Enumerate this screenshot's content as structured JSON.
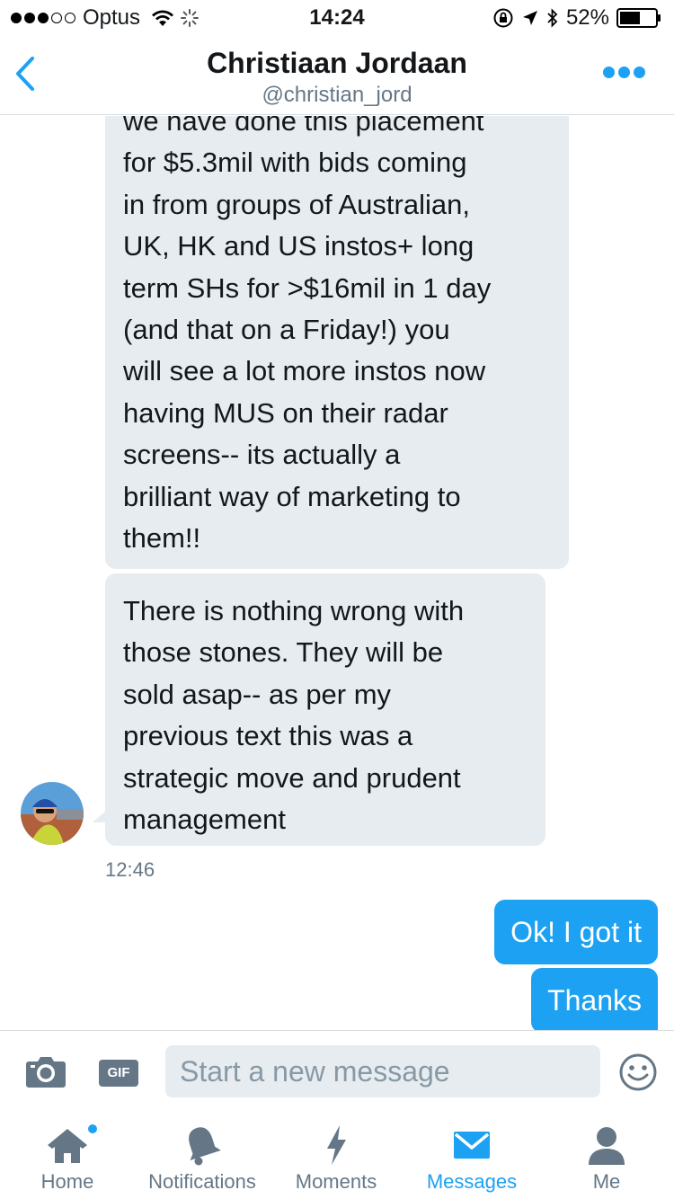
{
  "status_bar": {
    "carrier": "Optus",
    "time": "14:24",
    "battery": "52%"
  },
  "header": {
    "name": "Christiaan Jordaan",
    "handle": "@christian_jord"
  },
  "messages": {
    "incoming_1": {
      "lines": [
        "we have done this placement",
        "for $5.3mil with bids coming",
        "in from groups of Australian,",
        "UK, HK and US instos+ long",
        "term SHs for >$16mil in 1 day",
        "(and that on a Friday!) you",
        "will see a lot more instos now",
        "having MUS on their radar",
        "screens-- its actually a",
        "brilliant way of marketing to",
        "them!!"
      ]
    },
    "incoming_2": {
      "lines": [
        "There is nothing wrong with",
        "those stones. They will be",
        "sold asap-- as per my",
        "previous text this was a",
        "strategic move and prudent",
        "management"
      ]
    },
    "timestamp": "12:46",
    "outgoing_1": "Ok! I got it",
    "outgoing_2": "Thanks"
  },
  "composer": {
    "gif_label": "GIF",
    "placeholder": "Start a new message"
  },
  "tabs": {
    "home": "Home",
    "notifications": "Notifications",
    "moments": "Moments",
    "messages": "Messages",
    "me": "Me"
  },
  "colors": {
    "accent": "#1da1f2",
    "bubble_incoming": "#e6ecf0",
    "text_secondary": "#657786"
  }
}
